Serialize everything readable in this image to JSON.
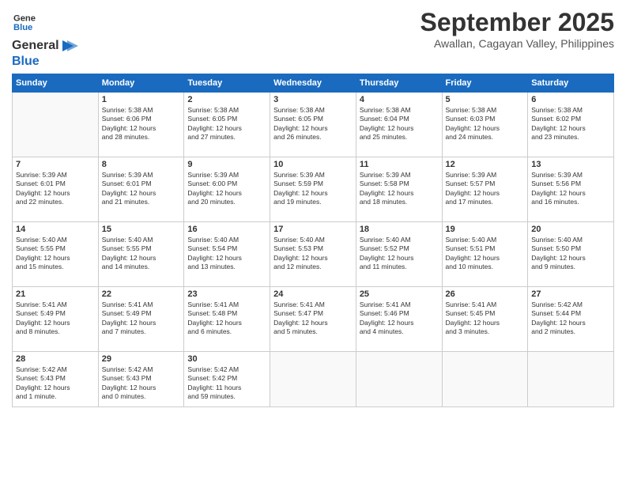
{
  "logo": {
    "line1": "General",
    "line2": "Blue"
  },
  "title": "September 2025",
  "subtitle": "Awallan, Cagayan Valley, Philippines",
  "days_of_week": [
    "Sunday",
    "Monday",
    "Tuesday",
    "Wednesday",
    "Thursday",
    "Friday",
    "Saturday"
  ],
  "weeks": [
    [
      {
        "day": "",
        "info": ""
      },
      {
        "day": "1",
        "info": "Sunrise: 5:38 AM\nSunset: 6:06 PM\nDaylight: 12 hours\nand 28 minutes."
      },
      {
        "day": "2",
        "info": "Sunrise: 5:38 AM\nSunset: 6:05 PM\nDaylight: 12 hours\nand 27 minutes."
      },
      {
        "day": "3",
        "info": "Sunrise: 5:38 AM\nSunset: 6:05 PM\nDaylight: 12 hours\nand 26 minutes."
      },
      {
        "day": "4",
        "info": "Sunrise: 5:38 AM\nSunset: 6:04 PM\nDaylight: 12 hours\nand 25 minutes."
      },
      {
        "day": "5",
        "info": "Sunrise: 5:38 AM\nSunset: 6:03 PM\nDaylight: 12 hours\nand 24 minutes."
      },
      {
        "day": "6",
        "info": "Sunrise: 5:38 AM\nSunset: 6:02 PM\nDaylight: 12 hours\nand 23 minutes."
      }
    ],
    [
      {
        "day": "7",
        "info": "Sunrise: 5:39 AM\nSunset: 6:01 PM\nDaylight: 12 hours\nand 22 minutes."
      },
      {
        "day": "8",
        "info": "Sunrise: 5:39 AM\nSunset: 6:01 PM\nDaylight: 12 hours\nand 21 minutes."
      },
      {
        "day": "9",
        "info": "Sunrise: 5:39 AM\nSunset: 6:00 PM\nDaylight: 12 hours\nand 20 minutes."
      },
      {
        "day": "10",
        "info": "Sunrise: 5:39 AM\nSunset: 5:59 PM\nDaylight: 12 hours\nand 19 minutes."
      },
      {
        "day": "11",
        "info": "Sunrise: 5:39 AM\nSunset: 5:58 PM\nDaylight: 12 hours\nand 18 minutes."
      },
      {
        "day": "12",
        "info": "Sunrise: 5:39 AM\nSunset: 5:57 PM\nDaylight: 12 hours\nand 17 minutes."
      },
      {
        "day": "13",
        "info": "Sunrise: 5:39 AM\nSunset: 5:56 PM\nDaylight: 12 hours\nand 16 minutes."
      }
    ],
    [
      {
        "day": "14",
        "info": "Sunrise: 5:40 AM\nSunset: 5:55 PM\nDaylight: 12 hours\nand 15 minutes."
      },
      {
        "day": "15",
        "info": "Sunrise: 5:40 AM\nSunset: 5:55 PM\nDaylight: 12 hours\nand 14 minutes."
      },
      {
        "day": "16",
        "info": "Sunrise: 5:40 AM\nSunset: 5:54 PM\nDaylight: 12 hours\nand 13 minutes."
      },
      {
        "day": "17",
        "info": "Sunrise: 5:40 AM\nSunset: 5:53 PM\nDaylight: 12 hours\nand 12 minutes."
      },
      {
        "day": "18",
        "info": "Sunrise: 5:40 AM\nSunset: 5:52 PM\nDaylight: 12 hours\nand 11 minutes."
      },
      {
        "day": "19",
        "info": "Sunrise: 5:40 AM\nSunset: 5:51 PM\nDaylight: 12 hours\nand 10 minutes."
      },
      {
        "day": "20",
        "info": "Sunrise: 5:40 AM\nSunset: 5:50 PM\nDaylight: 12 hours\nand 9 minutes."
      }
    ],
    [
      {
        "day": "21",
        "info": "Sunrise: 5:41 AM\nSunset: 5:49 PM\nDaylight: 12 hours\nand 8 minutes."
      },
      {
        "day": "22",
        "info": "Sunrise: 5:41 AM\nSunset: 5:49 PM\nDaylight: 12 hours\nand 7 minutes."
      },
      {
        "day": "23",
        "info": "Sunrise: 5:41 AM\nSunset: 5:48 PM\nDaylight: 12 hours\nand 6 minutes."
      },
      {
        "day": "24",
        "info": "Sunrise: 5:41 AM\nSunset: 5:47 PM\nDaylight: 12 hours\nand 5 minutes."
      },
      {
        "day": "25",
        "info": "Sunrise: 5:41 AM\nSunset: 5:46 PM\nDaylight: 12 hours\nand 4 minutes."
      },
      {
        "day": "26",
        "info": "Sunrise: 5:41 AM\nSunset: 5:45 PM\nDaylight: 12 hours\nand 3 minutes."
      },
      {
        "day": "27",
        "info": "Sunrise: 5:42 AM\nSunset: 5:44 PM\nDaylight: 12 hours\nand 2 minutes."
      }
    ],
    [
      {
        "day": "28",
        "info": "Sunrise: 5:42 AM\nSunset: 5:43 PM\nDaylight: 12 hours\nand 1 minute."
      },
      {
        "day": "29",
        "info": "Sunrise: 5:42 AM\nSunset: 5:43 PM\nDaylight: 12 hours\nand 0 minutes."
      },
      {
        "day": "30",
        "info": "Sunrise: 5:42 AM\nSunset: 5:42 PM\nDaylight: 11 hours\nand 59 minutes."
      },
      {
        "day": "",
        "info": ""
      },
      {
        "day": "",
        "info": ""
      },
      {
        "day": "",
        "info": ""
      },
      {
        "day": "",
        "info": ""
      }
    ]
  ]
}
